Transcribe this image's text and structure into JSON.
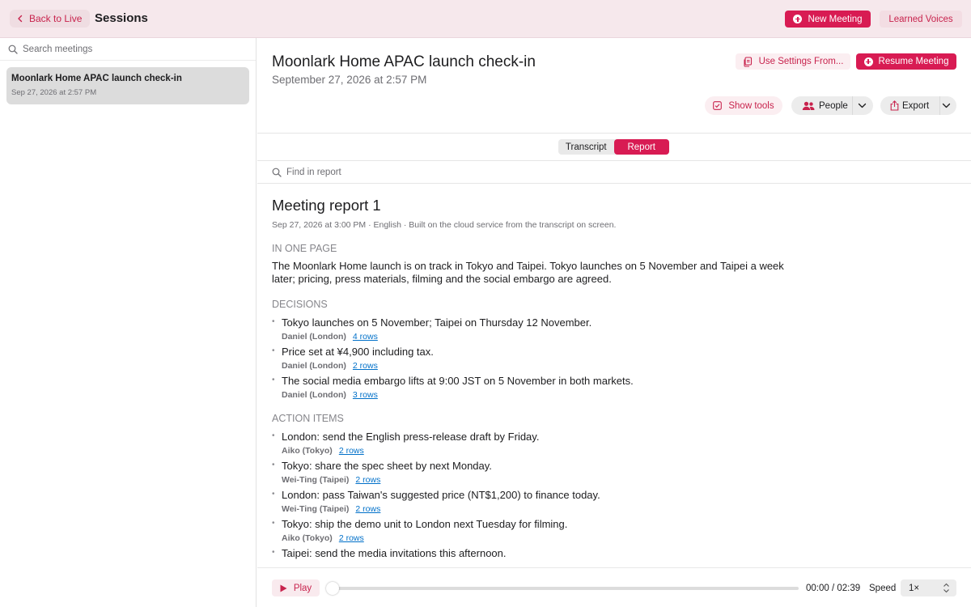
{
  "topbar": {
    "back_label": "Back to Live",
    "title": "Sessions",
    "new_meeting_label": "New Meeting",
    "learned_voices_label": "Learned Voices"
  },
  "sidebar": {
    "search_placeholder": "Search meetings",
    "sessions": [
      {
        "title": "Moonlark Home APAC launch check-in",
        "date": "Sep 27, 2026 at 2:57 PM"
      }
    ]
  },
  "meeting": {
    "title": "Moonlark Home APAC launch check-in",
    "date": "September 27, 2026 at 2:57 PM",
    "use_settings_label": "Use Settings From...",
    "resume_label": "Resume Meeting",
    "show_tools_label": "Show tools",
    "people_label": "People",
    "export_label": "Export"
  },
  "tabs": [
    {
      "label": "Transcript",
      "active": false
    },
    {
      "label": "Report",
      "active": true
    }
  ],
  "find_placeholder": "Find in report",
  "report": {
    "title": "Meeting report 1",
    "meta": "Sep 27, 2026 at 3:00 PM · English · Built on the cloud service from the transcript on screen.",
    "one_page_heading": "IN ONE PAGE",
    "summary": "The Moonlark Home launch is on track in Tokyo and Taipei. Tokyo launches on 5 November and Taipei a week later; pricing, press materials, filming and the social embargo are agreed.",
    "decisions_heading": "DECISIONS",
    "decisions": [
      {
        "text": "Tokyo launches on 5 November; Taipei on Thursday 12 November.",
        "by": "Daniel (London)",
        "rows": "4 rows"
      },
      {
        "text": "Price set at ¥4,900 including tax.",
        "by": "Daniel (London)",
        "rows": "2 rows"
      },
      {
        "text": "The social media embargo lifts at 9:00 JST on 5 November in both markets.",
        "by": "Daniel (London)",
        "rows": "3 rows"
      }
    ],
    "actions_heading": "ACTION ITEMS",
    "actions": [
      {
        "text": "London: send the English press-release draft by Friday.",
        "by": "Aiko (Tokyo)",
        "rows": "2 rows"
      },
      {
        "text": "Tokyo: share the spec sheet by next Monday.",
        "by": "Wei-Ting (Taipei)",
        "rows": "2 rows"
      },
      {
        "text": "London: pass Taiwan's suggested price (NT$1,200) to finance today.",
        "by": "Wei-Ting (Taipei)",
        "rows": "2 rows"
      },
      {
        "text": "Tokyo: ship the demo unit to London next Tuesday for filming.",
        "by": "Aiko (Tokyo)",
        "rows": "2 rows"
      },
      {
        "text": "Taipei: send the media invitations this afternoon.",
        "by": "",
        "rows": ""
      }
    ]
  },
  "player": {
    "play_label": "Play",
    "time": "00:00 / 02:39",
    "progress_fraction": 0,
    "speed_label": "Speed",
    "speed_value": "1×"
  },
  "colors": {
    "accent": "#d81b53",
    "topbar_bg": "#f6e8ec",
    "link": "#0070c9"
  },
  "icons": {
    "back": "chevron-left-icon",
    "new_meeting": "plus-circle-icon",
    "search": "search-icon",
    "use_settings": "document-copy-icon",
    "resume": "plus-circle-icon",
    "show_tools": "tools-checkbox-icon",
    "people": "people-icon",
    "export": "share-icon",
    "play": "play-icon"
  }
}
